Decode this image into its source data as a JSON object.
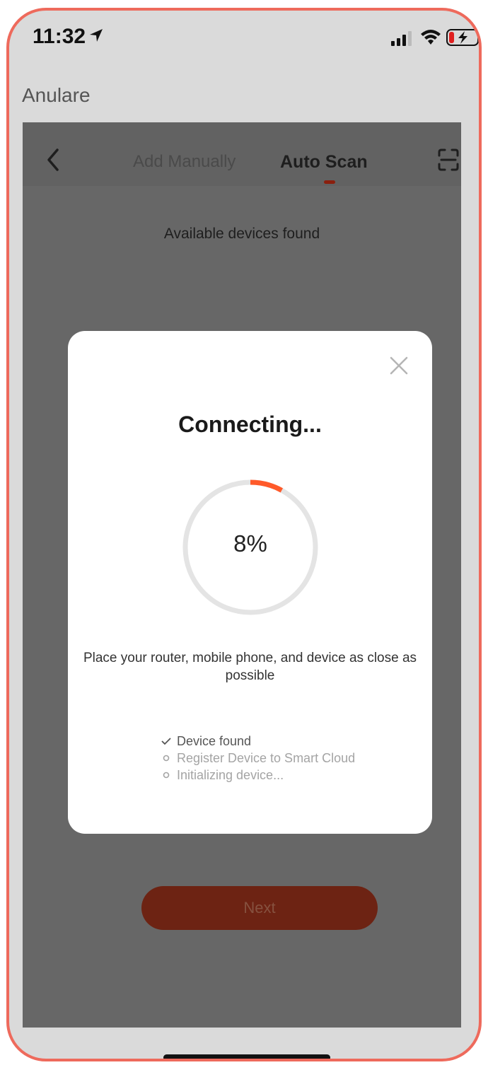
{
  "status_bar": {
    "time": "11:32",
    "icons": [
      "location-arrow-icon",
      "signal-icon",
      "wifi-icon",
      "battery-charging-icon"
    ]
  },
  "cancel_label": "Anulare",
  "nav": {
    "tabs": [
      {
        "label": "Add Manually",
        "active": false
      },
      {
        "label": "Auto Scan",
        "active": true
      }
    ],
    "icons": [
      "back-icon",
      "scan-icon"
    ]
  },
  "found_text": "Available devices found",
  "modal": {
    "title": "Connecting...",
    "progress": {
      "value": 8,
      "text": "8%"
    },
    "tip": "Place your router, mobile phone, and device as close as possible",
    "steps": [
      {
        "label": "Device found",
        "state": "done"
      },
      {
        "label": "Register Device to Smart Cloud",
        "state": "pending"
      },
      {
        "label": "Initializing device...",
        "state": "pending"
      }
    ]
  },
  "next_label": "Next",
  "colors": {
    "accent": "#ff5a2a",
    "frame_border": "#ee6a5c",
    "button_dimmed": "#6d2313",
    "overlay": "#676767"
  }
}
